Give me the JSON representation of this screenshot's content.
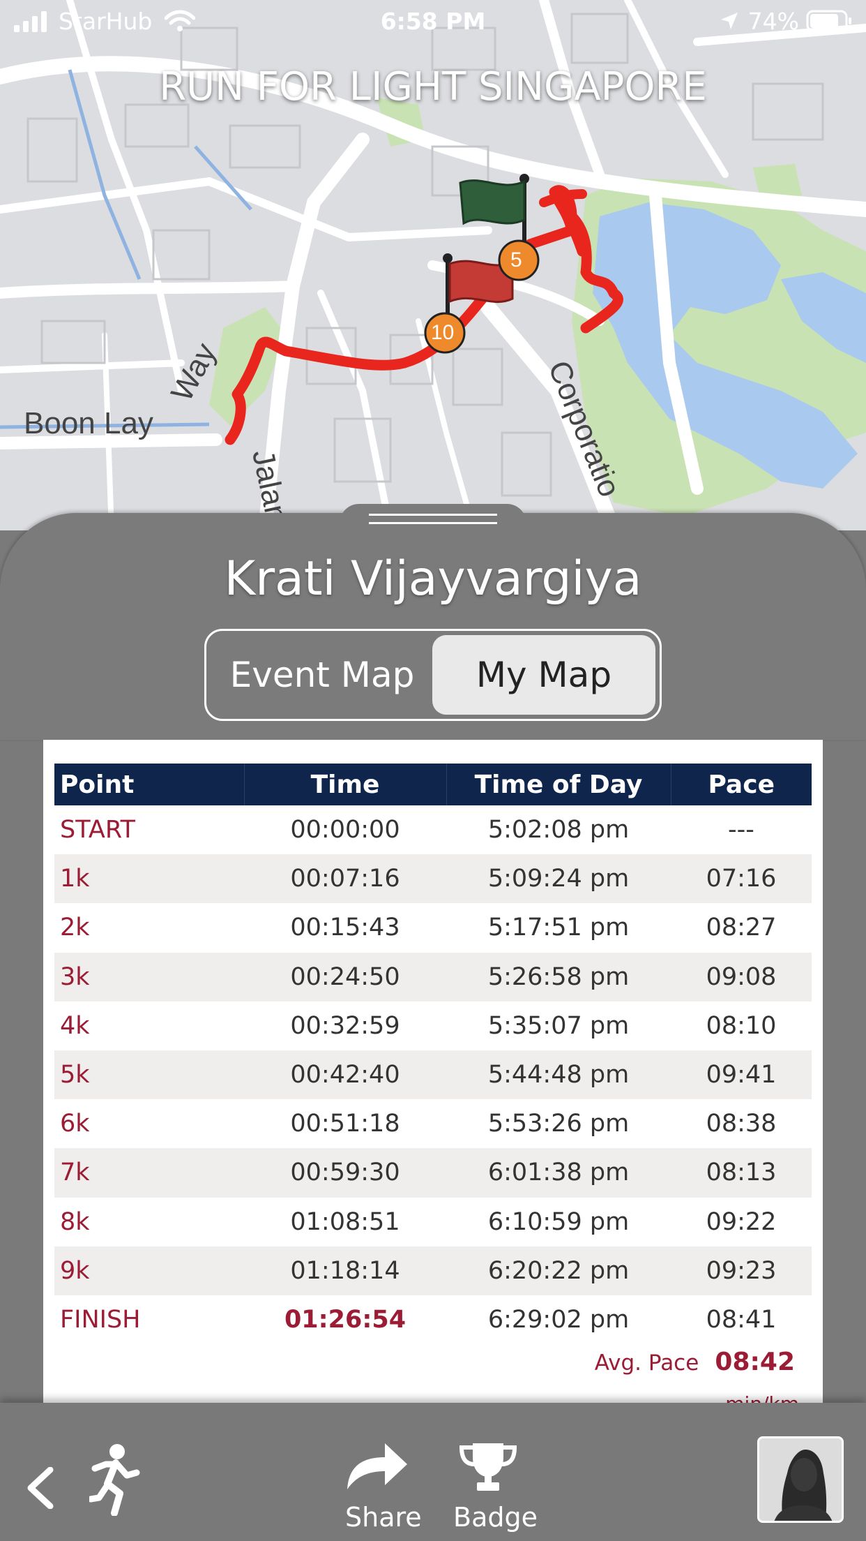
{
  "status_bar": {
    "carrier": "StarHub",
    "time": "6:58 PM",
    "battery": "74%"
  },
  "map": {
    "title": "RUN FOR LIGHT SINGAPORE",
    "street_boon_lay": "Boon Lay",
    "street_way": "Way",
    "street_jalan": "Jalan",
    "street_corporation": "Corporatio",
    "markers": [
      "5",
      "10"
    ]
  },
  "runner": {
    "name": "Krati Vijayvargiya"
  },
  "toggle": {
    "event_map": "Event Map",
    "my_map": "My Map",
    "selected": "My Map"
  },
  "splits": {
    "headers": [
      "Point",
      "Time",
      "Time of Day",
      "Pace"
    ],
    "rows": [
      {
        "point": "START",
        "time": "00:00:00",
        "tod": "5:02:08 pm",
        "pace": "---"
      },
      {
        "point": "1k",
        "time": "00:07:16",
        "tod": "5:09:24 pm",
        "pace": "07:16"
      },
      {
        "point": "2k",
        "time": "00:15:43",
        "tod": "5:17:51 pm",
        "pace": "08:27"
      },
      {
        "point": "3k",
        "time": "00:24:50",
        "tod": "5:26:58 pm",
        "pace": "09:08"
      },
      {
        "point": "4k",
        "time": "00:32:59",
        "tod": "5:35:07 pm",
        "pace": "08:10"
      },
      {
        "point": "5k",
        "time": "00:42:40",
        "tod": "5:44:48 pm",
        "pace": "09:41"
      },
      {
        "point": "6k",
        "time": "00:51:18",
        "tod": "5:53:26 pm",
        "pace": "08:38"
      },
      {
        "point": "7k",
        "time": "00:59:30",
        "tod": "6:01:38 pm",
        "pace": "08:13"
      },
      {
        "point": "8k",
        "time": "01:08:51",
        "tod": "6:10:59 pm",
        "pace": "09:22"
      },
      {
        "point": "9k",
        "time": "01:18:14",
        "tod": "6:20:22 pm",
        "pace": "09:23"
      },
      {
        "point": "FINISH",
        "time": "01:26:54",
        "tod": "6:29:02 pm",
        "pace": "08:41"
      }
    ],
    "avg_pace_label": "Avg. Pace",
    "avg_pace_value": "08:42",
    "avg_pace_unit": "min/km"
  },
  "bottom_bar": {
    "share_label": "Share",
    "badge_label": "Badge"
  },
  "icons": {
    "signal": "cellular-signal-icon",
    "wifi": "wifi-icon",
    "location": "location-arrow-icon",
    "battery": "battery-icon",
    "back": "chevron-left-icon",
    "runner": "runner-icon",
    "share": "share-arrow-icon",
    "badge": "trophy-icon",
    "avatar": "profile-avatar"
  },
  "colors": {
    "route": "#e8261e",
    "header_navy": "#10254b",
    "accent_red": "#9b1c34",
    "sheet_gray": "#7b7b7b"
  }
}
